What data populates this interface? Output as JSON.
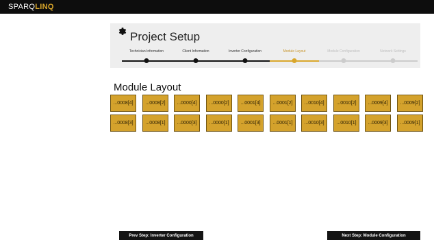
{
  "app": {
    "logo_light": "SPARQ",
    "logo_bold": "LINQ"
  },
  "setup": {
    "title": "Project Setup"
  },
  "steps": [
    {
      "label": "Technician Information",
      "state": "done"
    },
    {
      "label": "Client Information",
      "state": "done"
    },
    {
      "label": "Inverter Configuration",
      "state": "done"
    },
    {
      "label": "Module Layout",
      "state": "active"
    },
    {
      "label": "Module Configuration",
      "state": "pending"
    },
    {
      "label": "Network Settings",
      "state": "pending"
    }
  ],
  "layout": {
    "title": "Module Layout",
    "rows": [
      [
        "...0008[4]",
        "...0008[2]",
        "...0000[4]",
        "...0000[2]",
        "...0001[4]",
        "...0001[2]",
        "...0010[4]",
        "...0010[2]",
        "...0009[4]",
        "...0009[2]"
      ],
      [
        "...0008[3]",
        "...0008[1]",
        "...0000[3]",
        "...0000[1]",
        "...0001[3]",
        "...0001[1]",
        "...0010[3]",
        "...0010[1]",
        "...0009[3]",
        "...0009[1]"
      ]
    ]
  },
  "nav": {
    "prev_label": "Prev Step: Inverter Configuration",
    "next_label": "Next Step: Module Configuration"
  },
  "colors": {
    "done": "#111111",
    "active": "#d9a62a",
    "pending": "#cccccc",
    "module_fill": "#d4a22c"
  }
}
